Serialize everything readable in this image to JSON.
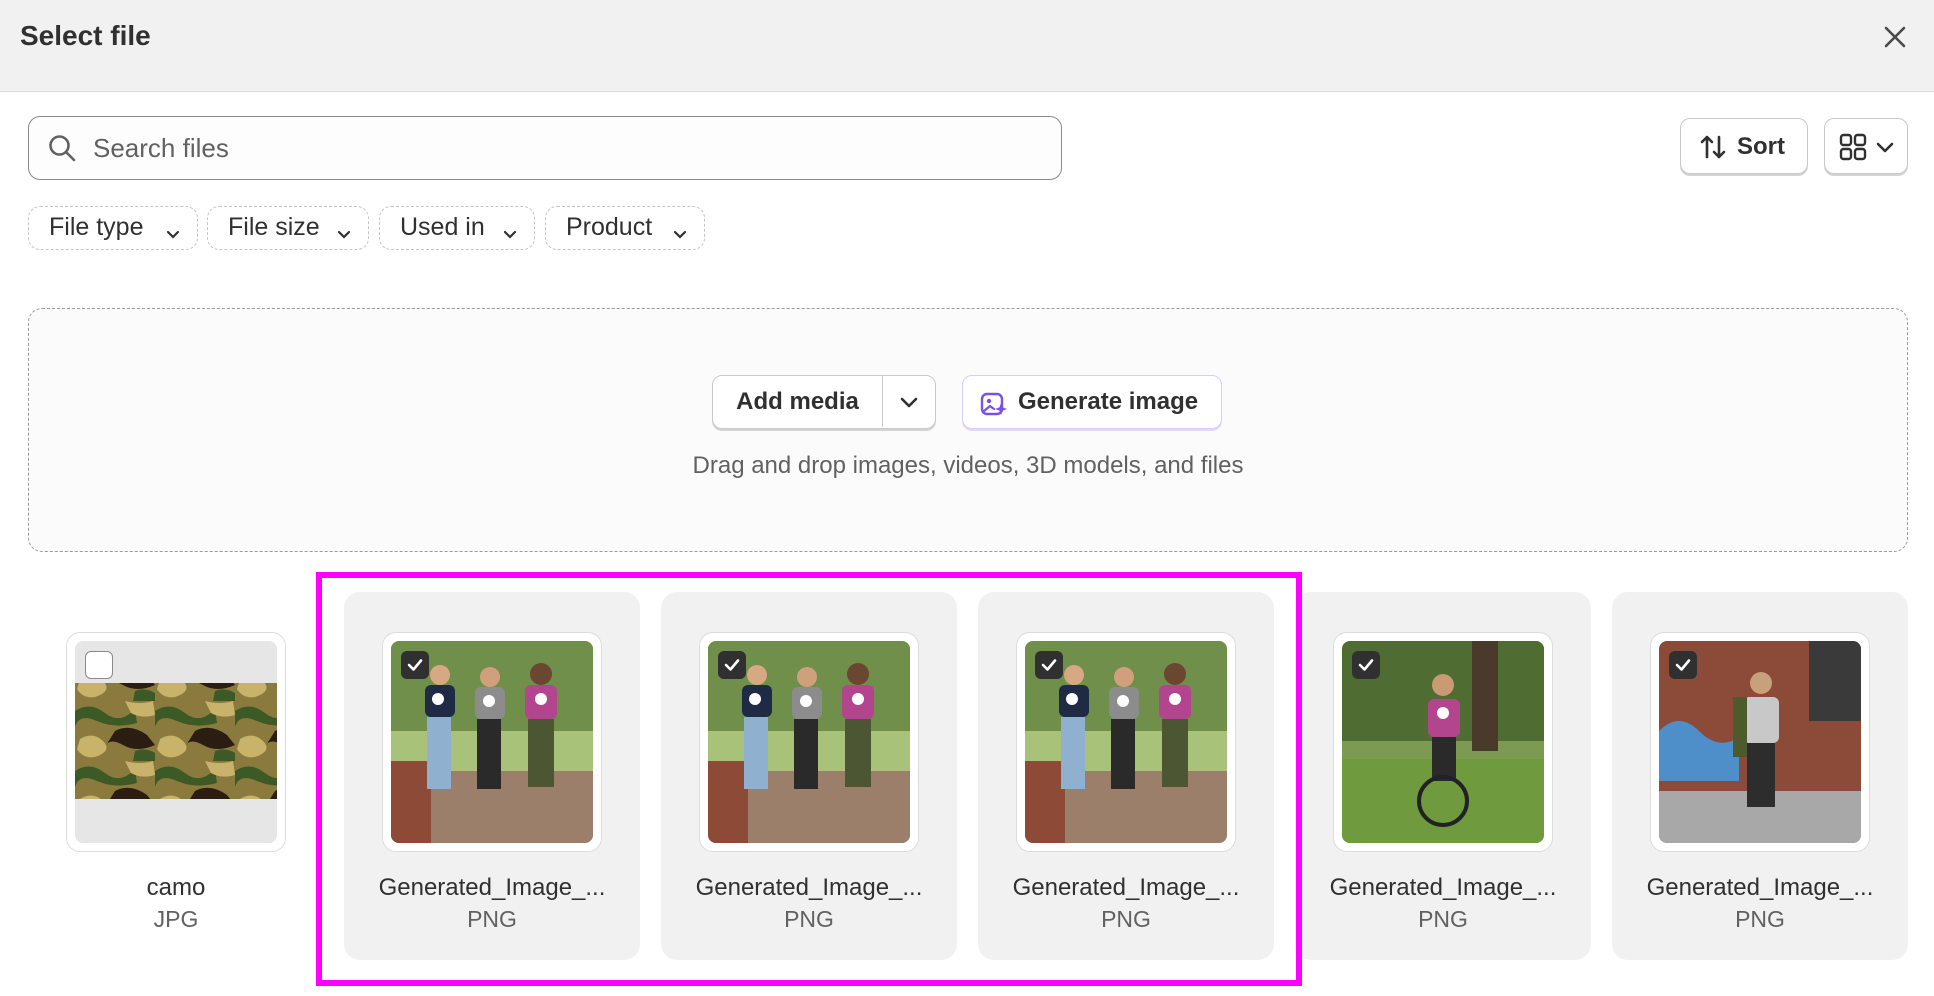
{
  "header": {
    "title": "Select file"
  },
  "search": {
    "placeholder": "Search files",
    "value": ""
  },
  "toolbar": {
    "sort_label": "Sort"
  },
  "filters": [
    {
      "label": "File type"
    },
    {
      "label": "File size"
    },
    {
      "label": "Used in"
    },
    {
      "label": "Product"
    }
  ],
  "dropzone": {
    "add_media_label": "Add media",
    "generate_label": "Generate image",
    "hint": "Drag and drop images, videos, 3D models, and files"
  },
  "files": [
    {
      "name": "camo",
      "type": "JPG",
      "selected": false,
      "thumb": "camo"
    },
    {
      "name": "Generated_Image_...",
      "type": "PNG",
      "selected": true,
      "thumb": "group"
    },
    {
      "name": "Generated_Image_...",
      "type": "PNG",
      "selected": true,
      "thumb": "group"
    },
    {
      "name": "Generated_Image_...",
      "type": "PNG",
      "selected": true,
      "thumb": "group"
    },
    {
      "name": "Generated_Image_...",
      "type": "PNG",
      "selected": true,
      "thumb": "bike"
    },
    {
      "name": "Generated_Image_...",
      "type": "PNG",
      "selected": true,
      "thumb": "wall"
    }
  ],
  "colors": {
    "accent_highlight": "#ff00ff",
    "checked": "#303030",
    "ai_purple": "#7b50e6"
  }
}
